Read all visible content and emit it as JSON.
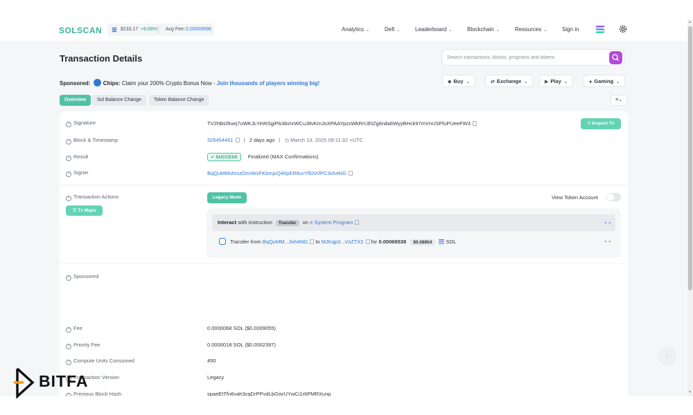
{
  "brand": {
    "logo": "SOLSCAN",
    "wordmark": "BITFA"
  },
  "price": {
    "value": "$133.17",
    "change": "+6.68%",
    "fee_label": "Avg Fee:",
    "fee_value": "0.00000896"
  },
  "nav": [
    {
      "label": "Analytics"
    },
    {
      "label": "Defi"
    },
    {
      "label": "Leaderboard"
    },
    {
      "label": "Blockchain"
    },
    {
      "label": "Resources"
    },
    {
      "label": "Sign in"
    }
  ],
  "page": {
    "title": "Transaction Details"
  },
  "search": {
    "placeholder": "Search transactions, blocks, programs and tokens"
  },
  "sponsor": {
    "prefix": "Sponsored:",
    "brand": "Chips:",
    "text": "Claim your 200% Crypto Bonus Now -",
    "link": "Join thousands of players winning big!"
  },
  "actions": [
    {
      "label": "Buy",
      "icon": "tag-icon"
    },
    {
      "label": "Exchange",
      "icon": "exchange-icon"
    },
    {
      "label": "Play",
      "icon": "play-icon"
    },
    {
      "label": "Gaming",
      "icon": "gamepad-icon"
    }
  ],
  "tabs": [
    {
      "label": "Overview",
      "active": true
    },
    {
      "label": "Sol Balance Change",
      "active": false
    },
    {
      "label": "Token Balance Change",
      "active": false
    }
  ],
  "details": {
    "signature_label": "Signature",
    "signature": "TV2NbtJ9uej7uWKJLYeWSgiPA3ikmrWCuJ8vKmJoXPAAYpzsWkRrUEtZg6nila6WyyBHck97mVnUSFfuPUeeFW3",
    "inspect_btn": "Inspect Tx",
    "block_label": "Block & Timestamp",
    "block": "326454461",
    "ago": "2 days ago",
    "timestamp": "March 13, 2025 09:11:32 +UTC",
    "result_label": "Result",
    "result_badge": "SUCCESS",
    "result_text": "Finalized (MAX Confirmations)",
    "signer_label": "Signer",
    "signer": "BqQuMMohmzDnnWxFKbmjxQ46pER8urYf6XKfPC3xh4NG"
  },
  "tx_actions": {
    "label": "Transaction Actions",
    "tx_maps": "Tx Maps",
    "legacy_btn": "Legacy Mode",
    "view_token": "View Token Account",
    "instr_prefix": "Interact",
    "instr_mid": "with instruction",
    "instr_type": "Transfer",
    "instr_on": "on",
    "program": "System Program",
    "transfer_from_label": "Transfer from",
    "from": "BqQuMM...3xh4NG",
    "to_label": "to",
    "to": "MJKqp3...VsZTX2",
    "for_label": "for",
    "amount": "0.00066538",
    "usd": "$0.08854",
    "token": "SOL"
  },
  "sponsored_label": "Sponsored",
  "fees": {
    "fee_label": "Fee",
    "fee": "0.0000068 SOL ($0.0009055)",
    "priority_label": "Priority Fee",
    "priority": "0.0000018 SOL ($0.0002397)",
    "cu_label": "Compute Units Consumed",
    "cu": "450",
    "version_label": "Transaction Version",
    "version": "Legacy",
    "prev_hash_label": "Previous Block Hash",
    "prev_hash": "spaeEtTfn6vah3cqDrPPvdLbGisrUYwCi1r6PMRXunp"
  },
  "colors": {
    "accent": "#4fc3a6",
    "link": "#2f79d6",
    "search_btn": "#b44bd8"
  }
}
